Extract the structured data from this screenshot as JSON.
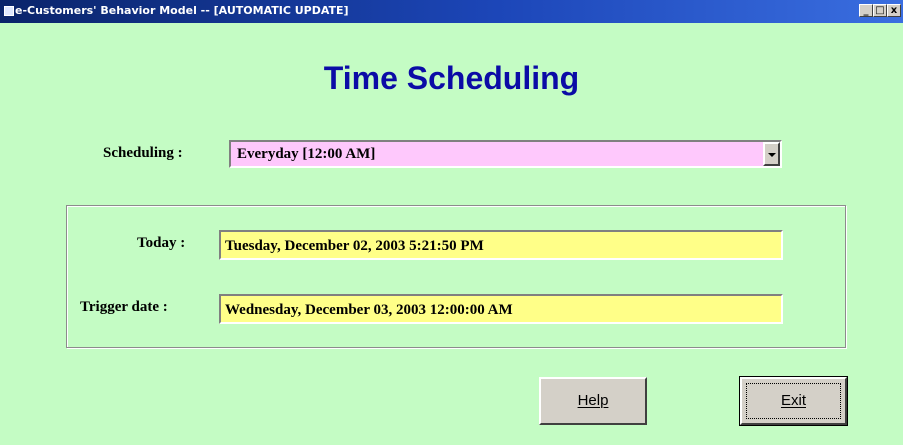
{
  "window": {
    "title": "e-Customers' Behavior Model -- [AUTOMATIC UPDATE]",
    "controls": [
      "_",
      "□",
      "x"
    ]
  },
  "heading": "Time Scheduling",
  "scheduling": {
    "label": "Scheduling :",
    "value": "Everyday [12:00 AM]"
  },
  "dates": {
    "today_label": "Today :",
    "today_value": "Tuesday, December 02, 2003 5:21:50 PM",
    "trigger_label": "Trigger date :",
    "trigger_value": "Wednesday, December 03, 2003 12:00:00 AM"
  },
  "buttons": {
    "help": "Help",
    "exit": "Exit"
  },
  "colors": {
    "background": "#c4fcc4",
    "heading": "#0b0ba6",
    "combo_bg": "#fec8fc",
    "field_bg": "#ffff88"
  }
}
